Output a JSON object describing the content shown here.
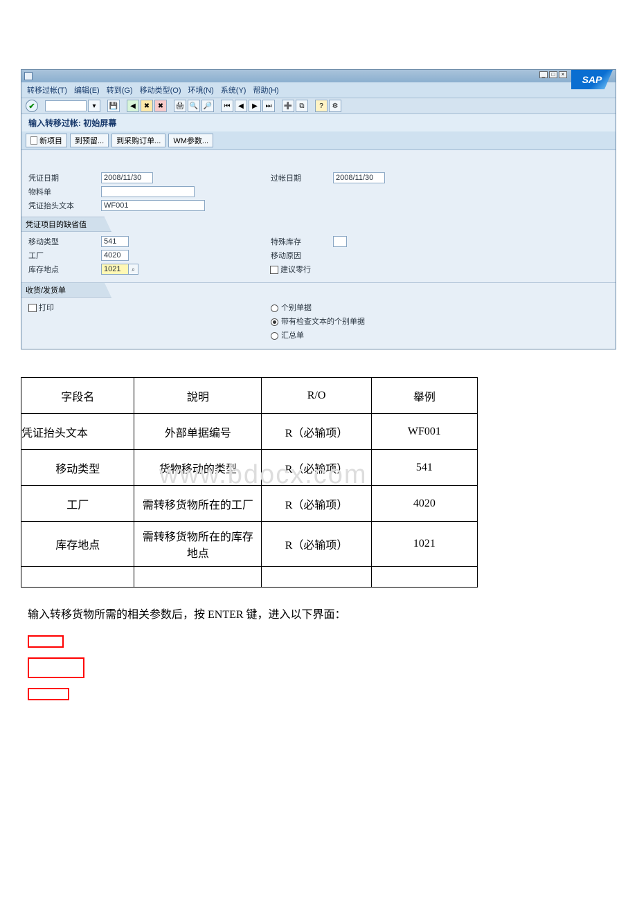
{
  "sap": {
    "menubar": [
      "转移过帐(T)",
      "编辑(E)",
      "转到(G)",
      "移动类型(O)",
      "环境(N)",
      "系统(Y)",
      "帮助(H)"
    ],
    "title": "输入转移过帐: 初始屏幕",
    "apptb": {
      "new_item": "新项目",
      "to_reserve": "到预留...",
      "to_po": "到采购订单...",
      "wm": "WM参数..."
    },
    "form": {
      "doc_date_label": "凭证日期",
      "doc_date": "2008/11/30",
      "post_date_label": "过帐日期",
      "post_date": "2008/11/30",
      "matdoc_label": "物料单",
      "matdoc": "",
      "header_text_label": "凭证抬头文本",
      "header_text": "WF001",
      "section_defaults": "凭证项目的缺省值",
      "move_type_label": "移动类型",
      "move_type": "541",
      "special_stock_label": "特殊库存",
      "plant_label": "工厂",
      "plant": "4020",
      "reason_label": "移动原因",
      "sloc_label": "库存地点",
      "sloc": "1021",
      "suggest_zero_label": "建议零行",
      "section_gr": "收货/发货单",
      "print_label": "打印",
      "radio1": "个别单据",
      "radio2": "带有检查文本的个别单据",
      "radio3": "汇总单"
    },
    "logo": "SAP"
  },
  "table": {
    "headers": [
      "字段名",
      "說明",
      "R/O",
      "舉例"
    ],
    "rows": [
      [
        "凭证抬头文本",
        "外部单据编号",
        "R（必输项）",
        "WF001"
      ],
      [
        "移动类型",
        "货物移动的类型",
        "R（必输项）",
        "541"
      ],
      [
        "工厂",
        "需转移货物所在的工厂",
        "R（必输项）",
        "4020"
      ],
      [
        "库存地点",
        "需转移货物所在的库存地点",
        "R（必输项）",
        "1021"
      ]
    ]
  },
  "instruction": "输入转移货物所需的相关参数后，按 ENTER 键，进入以下界面：",
  "watermark": "www.bdocx.com"
}
